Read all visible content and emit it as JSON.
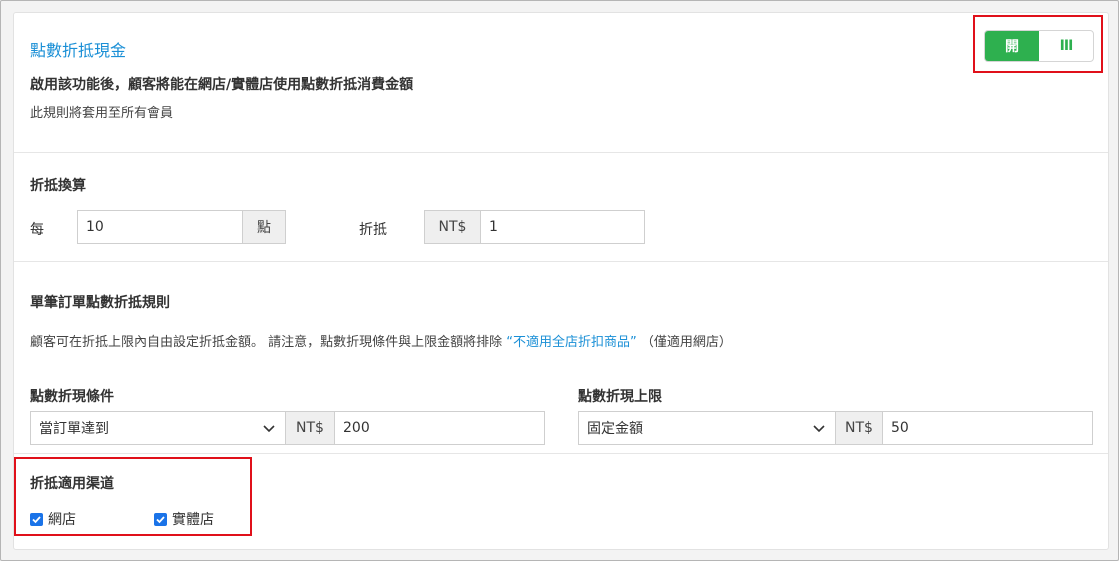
{
  "header": {
    "title": "點數折抵現金",
    "description_bold": "啟用該功能後，顧客將能在網店/實體店使用點數折抵消費金額",
    "description": "此規則將套用至所有會員",
    "toggle": {
      "on_label": "開",
      "handle_label": "III",
      "state": "on",
      "color": "#2eb04f"
    }
  },
  "conversion": {
    "title": "折抵換算",
    "per_label": "每",
    "points_value": "10",
    "points_unit": "點",
    "offset_label": "折抵",
    "currency": "NT$",
    "cash_value": "1"
  },
  "order_rules": {
    "title": "單筆訂單點數折抵規則",
    "note_prefix": "顧客可在折抵上限內自由設定折抵金額。 請注意，點數折現條件與上限金額將排除 ",
    "note_link": "“不適用全店折扣商品”",
    "note_suffix": " （僅適用網店）",
    "condition": {
      "label": "點數折現條件",
      "select_value": "當訂單達到",
      "currency": "NT$",
      "amount": "200"
    },
    "limit": {
      "label": "點數折現上限",
      "select_value": "固定金額",
      "currency": "NT$",
      "amount": "50"
    }
  },
  "channels": {
    "title": "折抵適用渠道",
    "online": {
      "label": "網店",
      "checked": true
    },
    "offline": {
      "label": "實體店",
      "checked": true
    }
  }
}
